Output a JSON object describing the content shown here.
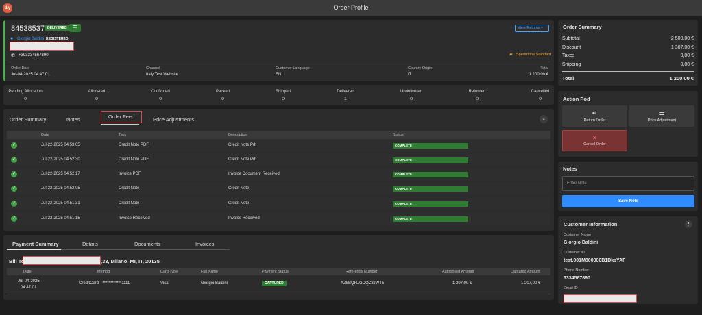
{
  "app": {
    "logo_text": "d/y",
    "title": "Order Profile"
  },
  "order": {
    "number": "84538537",
    "status_badge": "DELIVERED",
    "customer_name": "Giorgio Baldini",
    "customer_badge": "REGISTERED",
    "phone": "+393334567890",
    "view_returns": "View Returns",
    "shipping_method": "Spedizione Standard",
    "meta": [
      {
        "label": "Order Date",
        "value": "Jul-04-2025 04:47:01"
      },
      {
        "label": "Channel",
        "value": "Italy Test Website"
      },
      {
        "label": "Customer Language",
        "value": "EN"
      },
      {
        "label": "Country Origin",
        "value": "IT"
      },
      {
        "label": "Total",
        "value": "1 200,00 €"
      }
    ]
  },
  "stats": [
    {
      "label": "Pending Allocation",
      "value": "0"
    },
    {
      "label": "Allocated",
      "value": "0"
    },
    {
      "label": "Confirmed",
      "value": "0"
    },
    {
      "label": "Packed",
      "value": "0"
    },
    {
      "label": "Shipped",
      "value": "0"
    },
    {
      "label": "Delivered",
      "value": "1"
    },
    {
      "label": "Undelivered",
      "value": "0"
    },
    {
      "label": "Returned",
      "value": "0"
    },
    {
      "label": "Cancelled",
      "value": "0"
    }
  ],
  "tabs": [
    "Order Summary",
    "Notes",
    "Order Feed",
    "Price Adjustments"
  ],
  "feed": {
    "headers": [
      "Date",
      "Task",
      "Description",
      "Status"
    ],
    "rows": [
      {
        "date": "Jul-22-2025 04:53:05",
        "task": "Credit Note PDF",
        "description": "Credit Note Pdf",
        "status": "COMPLETE"
      },
      {
        "date": "Jul-22-2025 04:52:30",
        "task": "Credit Note PDF",
        "description": "Credit Note Pdf",
        "status": "COMPLETE"
      },
      {
        "date": "Jul-22-2025 04:52:17",
        "task": "Invoice PDF",
        "description": "Invoice Document Received",
        "status": "COMPLETE"
      },
      {
        "date": "Jul-22-2025 04:52:05",
        "task": "Credit Note",
        "description": "Credit Note",
        "status": "COMPLETE"
      },
      {
        "date": "Jul-22-2025 04:51:31",
        "task": "Credit Note",
        "description": "Credit Note",
        "status": "COMPLETE"
      },
      {
        "date": "Jul-22-2025 04:51:15",
        "task": "Invoice Received",
        "description": "Invoice Received",
        "status": "COMPLETE"
      }
    ]
  },
  "payment": {
    "tabs": [
      "Payment Summary",
      "Details",
      "Documents",
      "Invoices"
    ],
    "bill_to_label": "Bill To",
    "bill_to_address": ",33, Milano, MI, IT, 20135",
    "headers": [
      "Date",
      "Method",
      "Card Type",
      "Full Name",
      "Payment Status",
      "Reference Number",
      "Authorised Amount",
      "Captured Amount"
    ],
    "row": {
      "date": "Jul-04-2025",
      "time": "04:47:01",
      "method": "CreditCard - ************1111",
      "card_type": "Visa",
      "full_name": "Giorgio Baldini",
      "status": "CAPTURED",
      "reference": "XZ8BQHJGCQZ8JWT5",
      "authorised": "1 207,00 €",
      "captured": "1 207,00 €"
    }
  },
  "summary": {
    "title": "Order Summary",
    "rows": [
      {
        "label": "Subtotal",
        "value": "2 500,00 €"
      },
      {
        "label": "Discount",
        "value": "1 307,00 €"
      },
      {
        "label": "Taxes",
        "value": "0,00 €"
      },
      {
        "label": "Shipping",
        "value": "0,00 €"
      }
    ],
    "total_label": "Total",
    "total_value": "1 200,00 €"
  },
  "action_pod": {
    "title": "Action Pod",
    "return_order": "Return Order",
    "price_adjustment": "Price Adjustment",
    "cancel_order": "Cancel Order"
  },
  "notes": {
    "title": "Notes",
    "placeholder": "Enter Note",
    "save": "Save Note"
  },
  "customer": {
    "title": "Customer Information",
    "name_label": "Customer Name",
    "name": "Giorgio Baldini",
    "id_label": "Customer ID",
    "id": "test.001M800000B1DksYAF",
    "phone_label": "Phone Number",
    "phone": "3334567890",
    "email_label": "Email ID"
  },
  "colors": {
    "accent": "#4caf50",
    "primary_button": "#2f8cff",
    "danger": "#d94a4a",
    "badge": "#2e7d32"
  }
}
